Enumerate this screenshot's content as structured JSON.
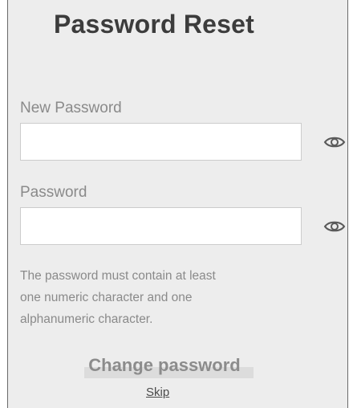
{
  "page": {
    "title": "Password Reset"
  },
  "fields": {
    "new_password": {
      "label": "New Password",
      "value": "",
      "placeholder": "",
      "toggle_icon": "eye-icon"
    },
    "password": {
      "label": "Password",
      "value": "",
      "placeholder": "",
      "toggle_icon": "eye-icon"
    }
  },
  "hint": {
    "lines": [
      "The password must contain at least",
      "one numeric character and one",
      "alphanumeric character."
    ]
  },
  "actions": {
    "change_label": "Change password",
    "skip_label": "Skip"
  },
  "colors": {
    "panel_background": "#ededed",
    "title_text": "#3c3c3c",
    "label_text": "#8a8a8a",
    "button_text": "#8c8c8c"
  }
}
